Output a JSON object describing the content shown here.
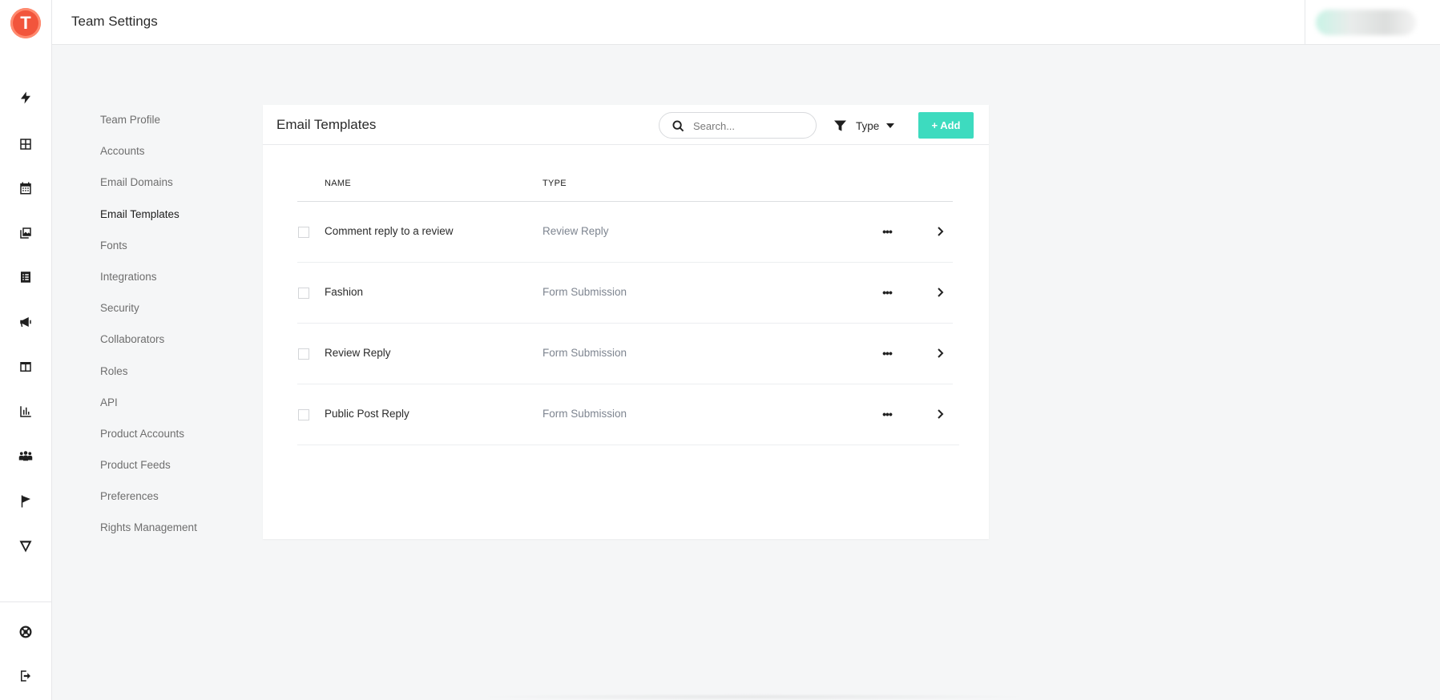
{
  "app": {
    "logo_letter": "T",
    "title": "Team Settings",
    "accent_color": "#3ddbbf",
    "logo_color": "#f2553c"
  },
  "rail": {
    "icons": [
      "bolt-icon",
      "grid-icon",
      "calendar-icon",
      "media-library-icon",
      "list-icon",
      "megaphone-icon",
      "columns-icon",
      "bar-chart-icon",
      "people-icon",
      "flag-icon",
      "v-logo-icon"
    ],
    "bottom_icons": [
      "help-lifebuoy-icon",
      "logout-icon"
    ]
  },
  "settings_nav": {
    "items": [
      {
        "label": "Team Profile"
      },
      {
        "label": "Accounts"
      },
      {
        "label": "Email Domains"
      },
      {
        "label": "Email Templates",
        "active": true
      },
      {
        "label": "Fonts"
      },
      {
        "label": "Integrations"
      },
      {
        "label": "Security"
      },
      {
        "label": "Collaborators"
      },
      {
        "label": "Roles"
      },
      {
        "label": "API"
      },
      {
        "label": "Product Accounts"
      },
      {
        "label": "Product Feeds"
      },
      {
        "label": "Preferences"
      },
      {
        "label": "Rights Management"
      }
    ]
  },
  "panel": {
    "title": "Email Templates",
    "search_placeholder": "Search...",
    "search_value": "",
    "filter_label": "Type",
    "add_label": "+ Add",
    "columns": {
      "name": "NAME",
      "type": "TYPE"
    },
    "rows": [
      {
        "name": "Comment reply to a review",
        "type": "Review Reply"
      },
      {
        "name": "Fashion",
        "type": "Form Submission"
      },
      {
        "name": "Review Reply",
        "type": "Form Submission"
      },
      {
        "name": "Public Post Reply",
        "type": "Form Submission"
      }
    ],
    "more_glyph": "•••"
  }
}
